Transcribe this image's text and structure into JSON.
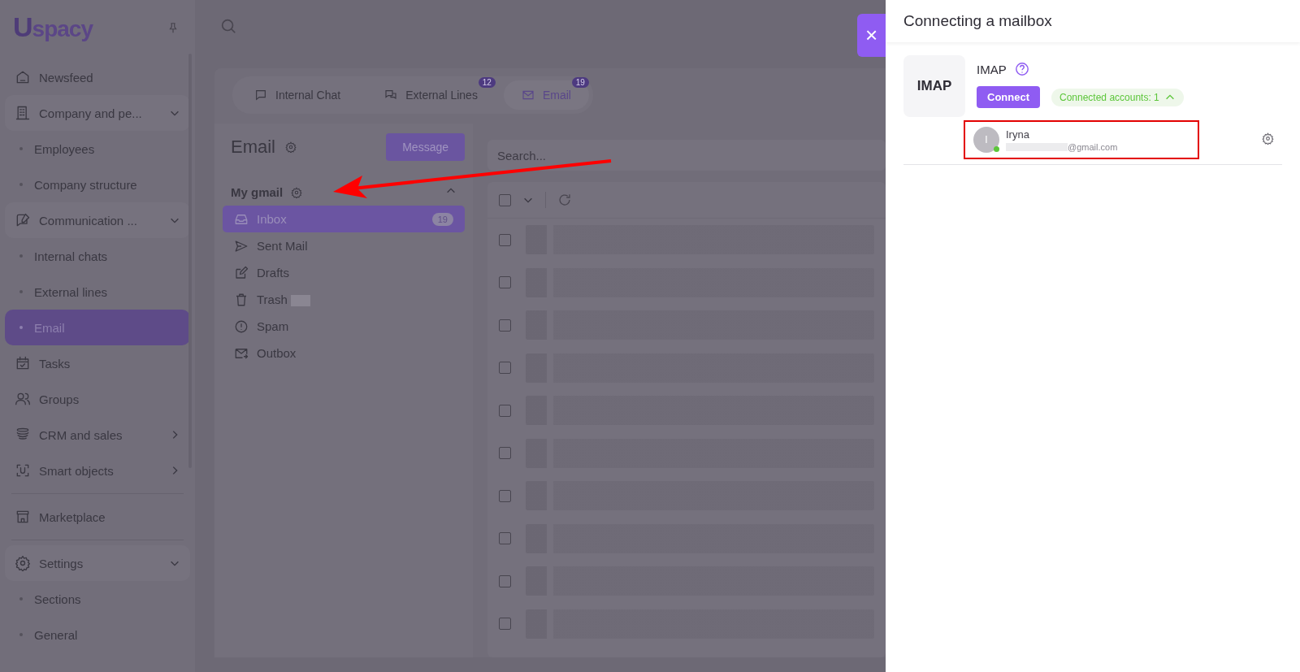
{
  "sidebar": {
    "logo": "Uspacy",
    "items": [
      {
        "kind": "link",
        "label": "Newsfeed",
        "selected": false
      },
      {
        "kind": "group",
        "label": "Company and pe...",
        "expanded": true,
        "children": [
          {
            "label": "Employees",
            "selected": false
          },
          {
            "label": "Company structure",
            "selected": false
          }
        ]
      },
      {
        "kind": "group",
        "label": "Communication ...",
        "expanded": true,
        "children": [
          {
            "label": "Internal chats",
            "selected": false
          },
          {
            "label": "External lines",
            "selected": false
          },
          {
            "label": "Email",
            "selected": true
          }
        ]
      },
      {
        "kind": "link",
        "label": "Tasks",
        "selected": false
      },
      {
        "kind": "link",
        "label": "Groups",
        "selected": false
      },
      {
        "kind": "group",
        "label": "CRM and sales",
        "expanded": false
      },
      {
        "kind": "group",
        "label": "Smart objects",
        "expanded": false
      },
      {
        "kind": "divider"
      },
      {
        "kind": "link",
        "label": "Marketplace",
        "selected": false
      },
      {
        "kind": "divider"
      },
      {
        "kind": "group",
        "label": "Settings",
        "expanded": true,
        "children": [
          {
            "label": "Sections",
            "selected": false
          },
          {
            "label": "General",
            "selected": false
          }
        ]
      }
    ]
  },
  "tabs": [
    {
      "label": "Internal Chat",
      "selected": false
    },
    {
      "label": "External Lines",
      "badge": "12",
      "selected": false
    },
    {
      "label": "Email",
      "badge": "19",
      "selected": true
    }
  ],
  "email_panel": {
    "title": "Email",
    "button": "Message",
    "account": {
      "name": "My gmail",
      "expanded": true
    },
    "folders": [
      {
        "label": "Inbox",
        "badge": "19",
        "selected": true
      },
      {
        "label": "Sent Mail",
        "selected": false
      },
      {
        "label": "Drafts",
        "selected": false
      },
      {
        "label": "Trash",
        "blurred_count": true,
        "selected": false
      },
      {
        "label": "Spam",
        "selected": false
      },
      {
        "label": "Outbox",
        "selected": false
      }
    ]
  },
  "mail_list": {
    "search": {
      "placeholder": "Search..."
    },
    "select_all": {
      "checked": false
    },
    "rows": [
      {
        "checked": false
      },
      {
        "checked": false
      },
      {
        "checked": false
      },
      {
        "checked": false
      },
      {
        "checked": false
      },
      {
        "checked": false
      },
      {
        "checked": false
      },
      {
        "checked": false
      },
      {
        "checked": false
      },
      {
        "checked": false
      }
    ]
  },
  "drawer": {
    "close": "×",
    "title": "Connecting a mailbox",
    "provider": {
      "logo": "IMAP",
      "name": "IMAP",
      "button": "Connect",
      "connected": "Connected accounts: 1",
      "expanded": true
    },
    "accounts": [
      {
        "initial": "I",
        "name": "Iryna",
        "email": "@gmail.com",
        "online": true
      }
    ]
  }
}
